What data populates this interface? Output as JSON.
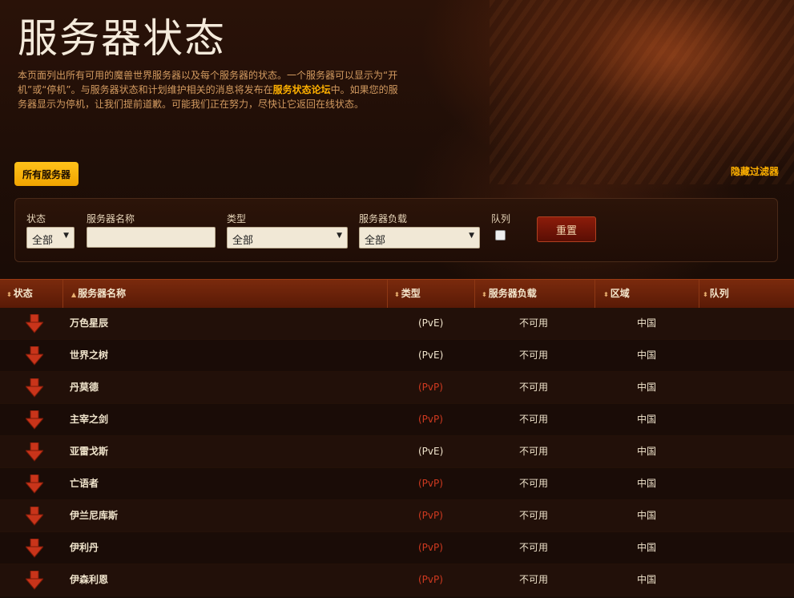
{
  "page": {
    "title": "服务器状态",
    "description_1": "本页面列出所有可用的魔兽世界服务器以及每个服务器的状态。一个服务器可以显示为“开机”或“停机”。与服务器状态和计划维护相关的消息将发布在",
    "forum_link": "服务状态论坛",
    "description_2": "中。如果您的服务器显示为停机，让我们提前道歉。可能我们正在努力，尽快让它返回在线状态。"
  },
  "buttons": {
    "all_servers": "所有服务器",
    "hide_filter": "隐藏过滤器",
    "reset": "重置"
  },
  "filters": {
    "status_label": "状态",
    "status_value": "全部",
    "name_label": "服务器名称",
    "name_value": "",
    "type_label": "类型",
    "type_value": "全部",
    "load_label": "服务器负载",
    "load_value": "全部",
    "queue_label": "队列",
    "queue_checked": false
  },
  "table": {
    "headers": {
      "status": "状态",
      "name": "服务器名称",
      "type": "类型",
      "load": "服务器负载",
      "region": "区域",
      "queue": "队列"
    },
    "rows": [
      {
        "name": "万色星辰",
        "type": "(PvE)",
        "load": "不可用",
        "region": "中国"
      },
      {
        "name": "世界之树",
        "type": "(PvE)",
        "load": "不可用",
        "region": "中国"
      },
      {
        "name": "丹莫德",
        "type": "(PvP)",
        "load": "不可用",
        "region": "中国"
      },
      {
        "name": "主宰之剑",
        "type": "(PvP)",
        "load": "不可用",
        "region": "中国"
      },
      {
        "name": "亚雷戈斯",
        "type": "(PvE)",
        "load": "不可用",
        "region": "中国"
      },
      {
        "name": "亡语者",
        "type": "(PvP)",
        "load": "不可用",
        "region": "中国"
      },
      {
        "name": "伊兰尼库斯",
        "type": "(PvP)",
        "load": "不可用",
        "region": "中国"
      },
      {
        "name": "伊利丹",
        "type": "(PvP)",
        "load": "不可用",
        "region": "中国"
      },
      {
        "name": "伊森利恩",
        "type": "(PvP)",
        "load": "不可用",
        "region": "中国"
      }
    ]
  },
  "colors": {
    "accent": "#ffb100",
    "pvp": "#d03a20",
    "down_arrow": "#c8341a"
  }
}
